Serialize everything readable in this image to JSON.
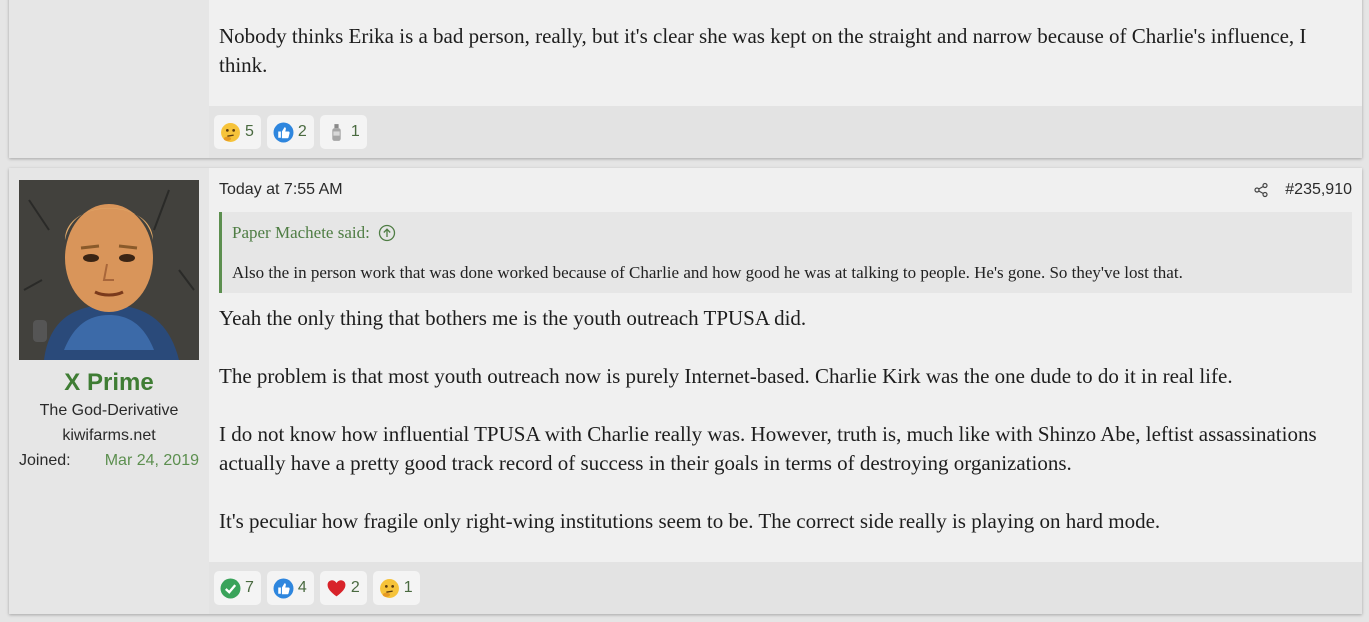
{
  "post_prev": {
    "body": [
      "Nobody thinks Erika is a bad person, really, but it's clear she was kept on the straight and narrow because of Charlie's influence, I think."
    ],
    "reactions": [
      {
        "icon": "thinking-emoji-icon",
        "count": "5"
      },
      {
        "icon": "thumbs-up-icon",
        "count": "2"
      },
      {
        "icon": "bottle-icon",
        "count": "1"
      }
    ]
  },
  "post": {
    "user": {
      "name": "X Prime",
      "title": "The God-Derivative",
      "domain": "kiwifarms.net",
      "joined_label": "Joined:",
      "joined_date": "Mar 24, 2019"
    },
    "date": "Today at 7:55 AM",
    "number": "#235,910",
    "quote": {
      "author": "Paper Machete said:",
      "text": "Also the in person work that was done worked because of Charlie and how good he was at talking to people. He's gone. So they've lost that."
    },
    "body": [
      "Yeah the only thing that bothers me is the youth outreach TPUSA did.",
      "The problem is that most youth outreach now is purely Internet-based. Charlie Kirk was the one dude to do it in real life.",
      "I do not know how influential TPUSA with Charlie really was. However, truth is, much like with Shinzo Abe, leftist assassinations actually have a pretty good track record of success in their goals in terms of destroying organizations.",
      "It's peculiar how fragile only right-wing institutions seem to be. The correct side really is playing on hard mode."
    ],
    "reactions": [
      {
        "icon": "check-icon",
        "count": "7"
      },
      {
        "icon": "thumbs-up-icon",
        "count": "4"
      },
      {
        "icon": "heart-icon",
        "count": "2"
      },
      {
        "icon": "thinking-emoji-icon",
        "count": "1"
      }
    ]
  },
  "colors": {
    "accent_green": "#3f7d34",
    "link_green": "#5c8f4f"
  }
}
